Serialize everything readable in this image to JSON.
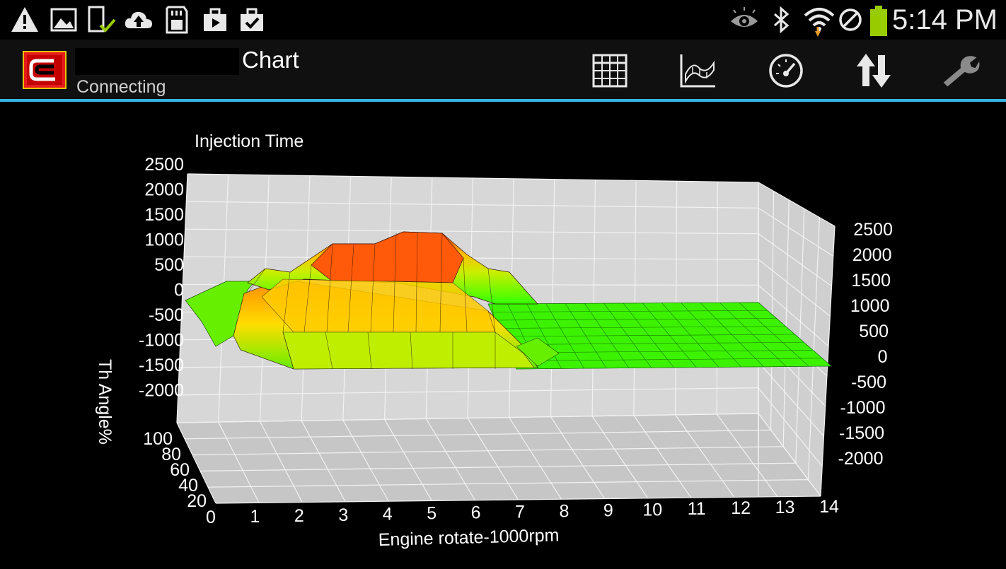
{
  "status_bar": {
    "time": "5:14 PM",
    "left_icons": [
      "warning-icon",
      "image-icon",
      "device-check-icon",
      "cloud-upload-icon",
      "sd-card-icon",
      "briefcase-play-icon",
      "briefcase-check-icon"
    ],
    "right_icons": [
      "eye-icon",
      "bluetooth-icon",
      "wifi-icon",
      "no-sim-icon",
      "battery-icon"
    ]
  },
  "action_bar": {
    "title": "Chart",
    "subtitle": "Connecting",
    "tools": [
      "table-icon",
      "surface-chart-icon",
      "gauge-icon",
      "sort-arrows-icon",
      "wrench-icon"
    ]
  },
  "colors": {
    "accent": "#33b5e5",
    "grid_wall": "#d4d4d4",
    "surface_low": "#33ff00",
    "surface_mid": "#ffcc00",
    "surface_high": "#ff3300"
  },
  "chart_data": {
    "type": "surface3d",
    "title": "Injection Time",
    "xlabel": "Engine rotate-1000rpm",
    "ylabel": "Th Angle%",
    "x_ticks": [
      "0",
      "1",
      "2",
      "3",
      "4",
      "5",
      "6",
      "7",
      "8",
      "9",
      "10",
      "11",
      "12",
      "13",
      "14"
    ],
    "y_ticks": [
      "20",
      "40",
      "60",
      "80",
      "100"
    ],
    "z_ticks": [
      "2500",
      "2000",
      "1500",
      "1000",
      "500",
      "0",
      "-500",
      "-1000",
      "-1500",
      "-2000"
    ],
    "xlim": [
      0,
      14
    ],
    "ylim": [
      0,
      100
    ],
    "zlim": [
      -2000,
      2500
    ]
  }
}
